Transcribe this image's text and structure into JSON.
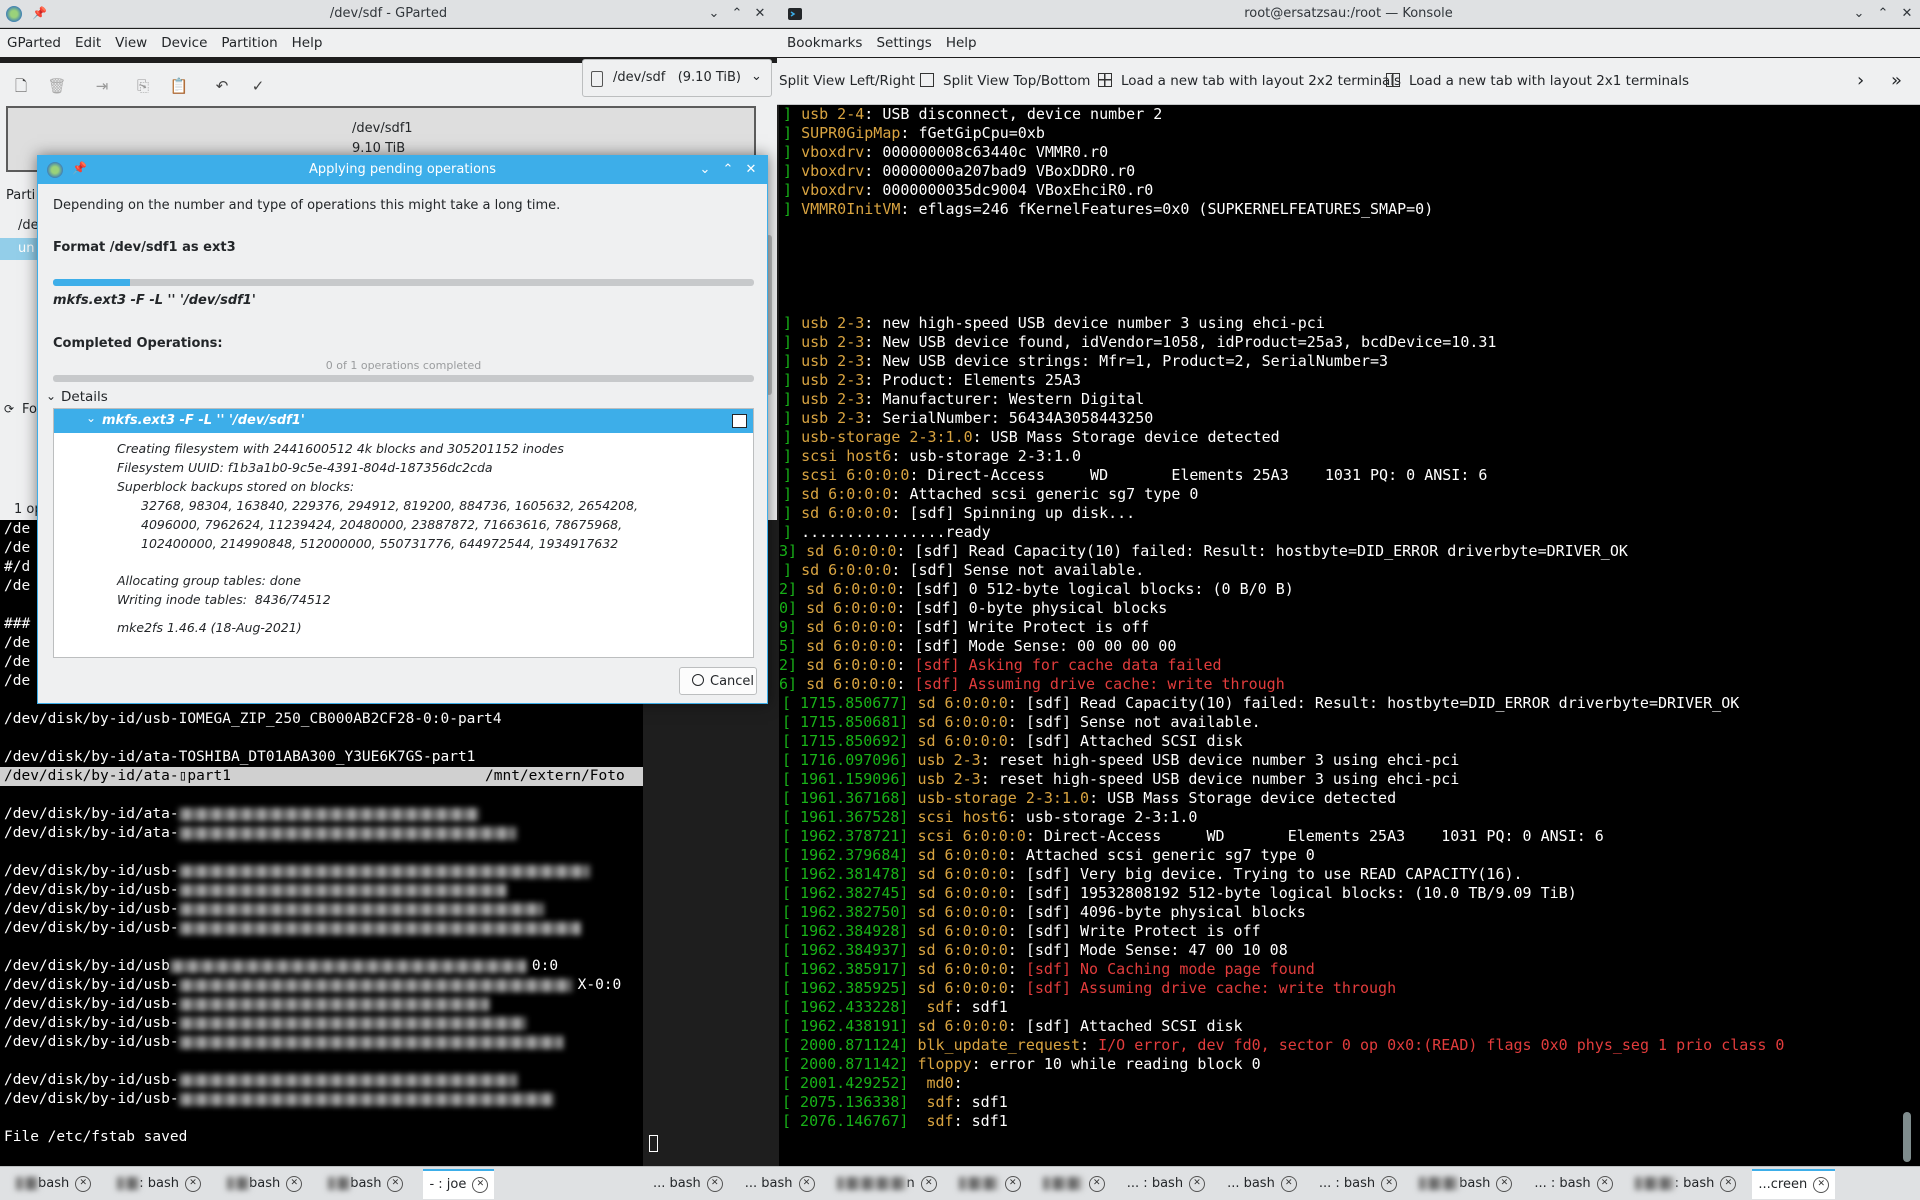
{
  "gparted": {
    "title": "/dev/sdf - GParted",
    "menu": [
      "GParted",
      "Edit",
      "View",
      "Device",
      "Partition",
      "Help"
    ],
    "device_selector": "/dev/sdf   (9.10 TiB)",
    "disk_label": "/dev/sdf1",
    "disk_size": "9.10 TiB",
    "left_edge_fragments": [
      "Parti",
      "/de",
      "un",
      "Fo",
      "1 op"
    ]
  },
  "dialog": {
    "title": "Applying pending operations",
    "intro": "Depending on the number and type of operations this might take a long time.",
    "operation": "Format /dev/sdf1 as ext3",
    "command": "mkfs.ext3 -F -L '' '/dev/sdf1'",
    "current_progress": 0.11,
    "completed_heading": "Completed Operations:",
    "completed_text": "0 of 1 operations completed",
    "completed_progress": 0,
    "details_label": "Details",
    "details_header": "mkfs.ext3 -F -L '' '/dev/sdf1'",
    "details_lines": [
      "Creating filesystem with 2441600512 4k blocks and 305201152 inodes",
      "Filesystem UUID: f1b3a1b0-9c5e-4391-804d-187356dc2cda",
      "Superblock backups stored on blocks:",
      "32768, 98304, 163840, 229376, 294912, 819200, 884736, 1605632, 2654208,",
      "4096000, 7962624, 11239424, 20480000, 23887872, 71663616, 78675968,",
      "102400000, 214990848, 512000000, 550731776, 644972544, 1934917632",
      "Allocating group tables: done",
      "Writing inode tables:  8436/74512",
      "mke2fs 1.46.4 (18-Aug-2021)"
    ],
    "cancel_label": "Cancel"
  },
  "joe_terminal": {
    "lines_left": [
      "/de",
      "/de",
      "#/d",
      "/de",
      "",
      "###",
      "/de",
      "/de",
      "/de"
    ],
    "line_zip": "/dev/disk/by-id/usb-IOMEGA_ZIP_250_CB000AB2CF28-0:0-part4",
    "line_toshiba": "/dev/disk/by-id/ata-TOSHIBA_DT01ABA300_Y3UE6K7GS-part1",
    "line_selected_a": "/dev/disk/by-id/ata-",
    "line_selected_b": "part1",
    "line_selected_mount": "/mnt/extern/Foto",
    "blurred_prefixes": [
      "/dev/disk/by-id/ata-",
      "/dev/disk/by-id/ata-",
      "",
      "/dev/disk/by-id/usb-",
      "/dev/disk/by-id/usb-",
      "/dev/disk/by-id/usb-",
      "/dev/disk/by-id/usb-",
      "",
      "/dev/disk/by-id/usb",
      "/dev/disk/by-id/usb-",
      "/dev/disk/by-id/usb-",
      "/dev/disk/by-id/usb-",
      "/dev/disk/by-id/usb-",
      "",
      "/dev/disk/by-id/usb-",
      "/dev/disk/by-id/usb-"
    ],
    "fragment_00": "0:0",
    "fragment_x": "X-0:0",
    "saved_message": "File /etc/fstab saved",
    "tabs": [
      {
        "label": "bash",
        "active": false
      },
      {
        "label": ": bash",
        "active": false
      },
      {
        "label": "bash",
        "active": false
      },
      {
        "label": "bash",
        "active": false
      },
      {
        "label": "- : joe",
        "active": true
      }
    ]
  },
  "konsole": {
    "title": "root@ersatzsau:/root — Konsole",
    "menu": [
      "Bookmarks",
      "Settings",
      "Help"
    ],
    "toolbar": [
      "Split View Left/Right",
      "Split View Top/Bottom",
      "Load a new tab with layout 2x2 terminals",
      "Load a new tab with layout 2x1 terminals"
    ],
    "lines": [
      {
        "ts": "]",
        "src": "usb 2-4",
        "sep": ": ",
        "msg": "USB disconnect, device number 2",
        "err": ""
      },
      {
        "ts": "]",
        "src": "SUPR0GipMap",
        "sep": ": ",
        "msg": "fGetGipCpu=0xb",
        "err": ""
      },
      {
        "ts": "]",
        "src": "vboxdrv",
        "sep": ": ",
        "msg": "000000008c63440c VMMR0.r0",
        "err": ""
      },
      {
        "ts": "]",
        "src": "vboxdrv",
        "sep": ": ",
        "msg": "00000000a207bad9 VBoxDDR0.r0",
        "err": ""
      },
      {
        "ts": "]",
        "src": "vboxdrv",
        "sep": ": ",
        "msg": "0000000035dc9004 VBoxEhciR0.r0",
        "err": ""
      },
      {
        "ts": "]",
        "src": "VMMR0InitVM",
        "sep": ": ",
        "msg": "eflags=246 fKernelFeatures=0x0 (SUPKERNELFEATURES_SMAP=0)",
        "err": ""
      },
      {
        "ts": "",
        "src": "",
        "sep": "",
        "msg": "",
        "err": ""
      },
      {
        "ts": "",
        "src": "",
        "sep": "",
        "msg": "",
        "err": ""
      },
      {
        "ts": "",
        "src": "",
        "sep": "",
        "msg": "",
        "err": ""
      },
      {
        "ts": "",
        "src": "",
        "sep": "",
        "msg": "",
        "err": ""
      },
      {
        "ts": "",
        "src": "",
        "sep": "",
        "msg": "",
        "err": ""
      },
      {
        "ts": "]",
        "src": "usb 2-3",
        "sep": ": ",
        "msg": "new high-speed USB device number 3 using ehci-pci",
        "err": ""
      },
      {
        "ts": "]",
        "src": "usb 2-3",
        "sep": ": ",
        "msg": "New USB device found, idVendor=1058, idProduct=25a3, bcdDevice=10.31",
        "err": ""
      },
      {
        "ts": "]",
        "src": "usb 2-3",
        "sep": ": ",
        "msg": "New USB device strings: Mfr=1, Product=2, SerialNumber=3",
        "err": ""
      },
      {
        "ts": "]",
        "src": "usb 2-3",
        "sep": ": ",
        "msg": "Product: Elements 25A3",
        "err": ""
      },
      {
        "ts": "]",
        "src": "usb 2-3",
        "sep": ": ",
        "msg": "Manufacturer: Western Digital",
        "err": ""
      },
      {
        "ts": "]",
        "src": "usb 2-3",
        "sep": ": ",
        "msg": "SerialNumber: 56434A3058443250",
        "err": ""
      },
      {
        "ts": "]",
        "src": "usb-storage 2-3:1.0",
        "sep": ": ",
        "msg": "USB Mass Storage device detected",
        "err": ""
      },
      {
        "ts": "]",
        "src": "scsi host6",
        "sep": ": ",
        "msg": "usb-storage 2-3:1.0",
        "err": ""
      },
      {
        "ts": "]",
        "src": "scsi 6:0:0:0",
        "sep": ": ",
        "msg": "Direct-Access     WD       Elements 25A3    1031 PQ: 0 ANSI: 6",
        "err": ""
      },
      {
        "ts": "]",
        "src": "sd 6:0:0:0",
        "sep": ": ",
        "msg": "Attached scsi generic sg7 type 0",
        "err": ""
      },
      {
        "ts": "]",
        "src": "sd 6:0:0:0",
        "sep": ": ",
        "msg": "[sdf] Spinning up disk...",
        "err": ""
      },
      {
        "ts": "]",
        "src": "",
        "sep": "",
        "msg": "................ready",
        "err": ""
      },
      {
        "ts": "3]",
        "src": "sd 6:0:0:0",
        "sep": ": ",
        "msg": "[sdf] Read Capacity(10) failed: Result: hostbyte=DID_ERROR driverbyte=DRIVER_OK",
        "err": ""
      },
      {
        "ts": "]",
        "src": "sd 6:0:0:0",
        "sep": ": ",
        "msg": "[sdf] Sense not available.",
        "err": ""
      },
      {
        "ts": "2]",
        "src": "sd 6:0:0:0",
        "sep": ": ",
        "msg": "[sdf] 0 512-byte logical blocks: (0 B/0 B)",
        "err": ""
      },
      {
        "ts": "0]",
        "src": "sd 6:0:0:0",
        "sep": ": ",
        "msg": "[sdf] 0-byte physical blocks",
        "err": ""
      },
      {
        "ts": "9]",
        "src": "sd 6:0:0:0",
        "sep": ": ",
        "msg": "[sdf] Write Protect is off",
        "err": ""
      },
      {
        "ts": "5]",
        "src": "sd 6:0:0:0",
        "sep": ": ",
        "msg": "[sdf] Mode Sense: 00 00 00 00",
        "err": ""
      },
      {
        "ts": "2]",
        "src": "sd 6:0:0:0",
        "sep": ": ",
        "msg": "",
        "err": "[sdf] Asking for cache data failed"
      },
      {
        "ts": "6]",
        "src": "sd 6:0:0:0",
        "sep": ": ",
        "msg": "",
        "err": "[sdf] Assuming drive cache: write through"
      },
      {
        "ts": "[ 1715.850677]",
        "src": "sd 6:0:0:0",
        "sep": ": ",
        "msg": "[sdf] Read Capacity(10) failed: Result: hostbyte=DID_ERROR driverbyte=DRIVER_OK",
        "err": ""
      },
      {
        "ts": "[ 1715.850681]",
        "src": "sd 6:0:0:0",
        "sep": ": ",
        "msg": "[sdf] Sense not available.",
        "err": ""
      },
      {
        "ts": "[ 1715.850692]",
        "src": "sd 6:0:0:0",
        "sep": ": ",
        "msg": "[sdf] Attached SCSI disk",
        "err": ""
      },
      {
        "ts": "[ 1716.097096]",
        "src": "usb 2-3",
        "sep": ": ",
        "msg": "reset high-speed USB device number 3 using ehci-pci",
        "err": ""
      },
      {
        "ts": "[ 1961.159096]",
        "src": "usb 2-3",
        "sep": ": ",
        "msg": "reset high-speed USB device number 3 using ehci-pci",
        "err": ""
      },
      {
        "ts": "[ 1961.367168]",
        "src": "usb-storage 2-3:1.0",
        "sep": ": ",
        "msg": "USB Mass Storage device detected",
        "err": ""
      },
      {
        "ts": "[ 1961.367528]",
        "src": "scsi host6",
        "sep": ": ",
        "msg": "usb-storage 2-3:1.0",
        "err": ""
      },
      {
        "ts": "[ 1962.378721]",
        "src": "scsi 6:0:0:0",
        "sep": ": ",
        "msg": "Direct-Access     WD       Elements 25A3    1031 PQ: 0 ANSI: 6",
        "err": ""
      },
      {
        "ts": "[ 1962.379684]",
        "src": "sd 6:0:0:0",
        "sep": ": ",
        "msg": "Attached scsi generic sg7 type 0",
        "err": ""
      },
      {
        "ts": "[ 1962.381478]",
        "src": "sd 6:0:0:0",
        "sep": ": ",
        "msg": "[sdf] Very big device. Trying to use READ CAPACITY(16).",
        "err": ""
      },
      {
        "ts": "[ 1962.382745]",
        "src": "sd 6:0:0:0",
        "sep": ": ",
        "msg": "[sdf] 19532808192 512-byte logical blocks: (10.0 TB/9.09 TiB)",
        "err": ""
      },
      {
        "ts": "[ 1962.382750]",
        "src": "sd 6:0:0:0",
        "sep": ": ",
        "msg": "[sdf] 4096-byte physical blocks",
        "err": ""
      },
      {
        "ts": "[ 1962.384928]",
        "src": "sd 6:0:0:0",
        "sep": ": ",
        "msg": "[sdf] Write Protect is off",
        "err": ""
      },
      {
        "ts": "[ 1962.384937]",
        "src": "sd 6:0:0:0",
        "sep": ": ",
        "msg": "[sdf] Mode Sense: 47 00 10 08",
        "err": ""
      },
      {
        "ts": "[ 1962.385917]",
        "src": "sd 6:0:0:0",
        "sep": ": ",
        "msg": "",
        "err": "[sdf] No Caching mode page found"
      },
      {
        "ts": "[ 1962.385925]",
        "src": "sd 6:0:0:0",
        "sep": ": ",
        "msg": "",
        "err": "[sdf] Assuming drive cache: write through"
      },
      {
        "ts": "[ 1962.433228]",
        "src": " sdf",
        "sep": ": ",
        "msg": "sdf1",
        "err": ""
      },
      {
        "ts": "[ 1962.438191]",
        "src": "sd 6:0:0:0",
        "sep": ": ",
        "msg": "[sdf] Attached SCSI disk",
        "err": ""
      },
      {
        "ts": "[ 2000.871124]",
        "src": "blk_update_request",
        "sep": ": ",
        "msg": "",
        "err": "I/O error, dev fd0, sector 0 op 0x0:(READ) flags 0x0 phys_seg 1 prio class 0"
      },
      {
        "ts": "[ 2000.871142]",
        "src": "floppy",
        "sep": ": ",
        "msg": "error 10 while reading block 0",
        "err": ""
      },
      {
        "ts": "[ 2001.429252]",
        "src": " md0",
        "sep": ":",
        "msg": "",
        "err": ""
      },
      {
        "ts": "[ 2075.136338]",
        "src": " sdf",
        "sep": ": ",
        "msg": "sdf1",
        "err": ""
      },
      {
        "ts": "[ 2076.146767]",
        "src": " sdf",
        "sep": ": ",
        "msg": "sdf1",
        "err": ""
      }
    ],
    "tabs": [
      "... bash",
      "... bash",
      "n",
      "",
      "",
      "... : bash",
      "... bash",
      "... : bash",
      "bash",
      "... : bash",
      ": bash",
      "...creen"
    ]
  },
  "colors": {
    "accent": "#3daee9",
    "timestamp": "#18b218",
    "source": "#d9a441",
    "error": "#e23c3c"
  }
}
